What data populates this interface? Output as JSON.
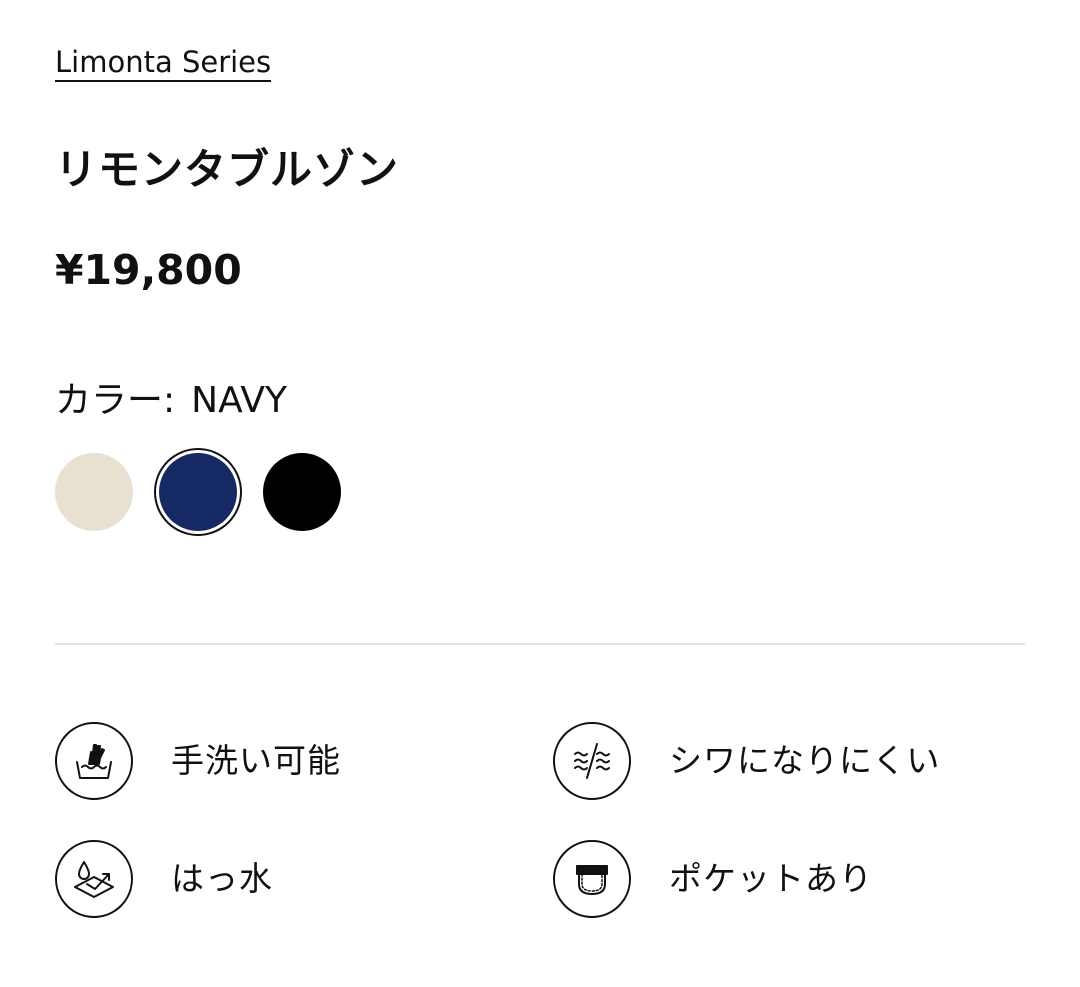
{
  "series": {
    "label": "Limonta Series"
  },
  "product": {
    "title": "リモンタブルゾン",
    "price": "¥19,800"
  },
  "color": {
    "label": "カラー:",
    "selected": "NAVY",
    "swatches": [
      {
        "name": "beige",
        "hex": "#e8e1d2",
        "selected": false
      },
      {
        "name": "navy",
        "hex": "#152a64",
        "selected": true
      },
      {
        "name": "black",
        "hex": "#000000",
        "selected": false
      }
    ]
  },
  "features": [
    {
      "icon": "hand-wash-icon",
      "label": "手洗い可能"
    },
    {
      "icon": "wrinkle-resistant-icon",
      "label": "シワになりにくい"
    },
    {
      "icon": "water-repellent-icon",
      "label": "はっ水"
    },
    {
      "icon": "pocket-icon",
      "label": "ポケットあり"
    }
  ]
}
